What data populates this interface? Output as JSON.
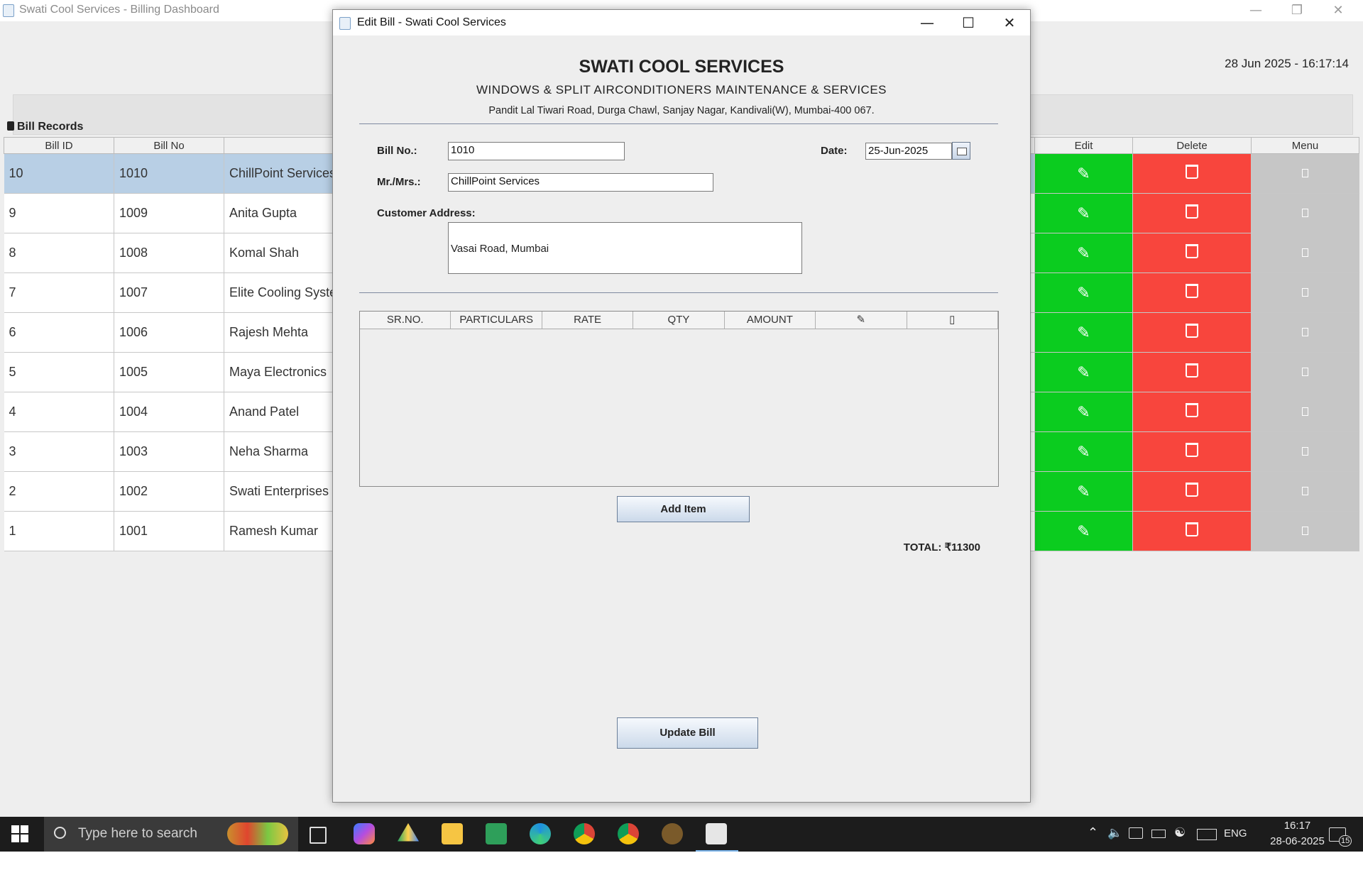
{
  "main_window": {
    "title": "Swati Cool Services - Billing Dashboard",
    "datetime": "28 Jun 2025 - 16:17:14",
    "records_label": "Bill Records",
    "columns": [
      "Bill ID",
      "Bill No",
      "Edit",
      "Delete",
      "Menu"
    ],
    "rows": [
      {
        "id": "10",
        "no": "1010",
        "name": "ChillPoint Services"
      },
      {
        "id": "9",
        "no": "1009",
        "name": "Anita Gupta"
      },
      {
        "id": "8",
        "no": "1008",
        "name": "Komal Shah"
      },
      {
        "id": "7",
        "no": "1007",
        "name": "Elite Cooling Syste"
      },
      {
        "id": "6",
        "no": "1006",
        "name": "Rajesh Mehta"
      },
      {
        "id": "5",
        "no": "1005",
        "name": "Maya Electronics"
      },
      {
        "id": "4",
        "no": "1004",
        "name": "Anand Patel"
      },
      {
        "id": "3",
        "no": "1003",
        "name": "Neha Sharma"
      },
      {
        "id": "2",
        "no": "1002",
        "name": "Swati Enterprises"
      },
      {
        "id": "1",
        "no": "1001",
        "name": "Ramesh Kumar"
      }
    ],
    "colors": {
      "edit": "#0bcc1f",
      "delete": "#f8453d",
      "menu": "#c6c6c6",
      "selected": "#b8cfe5"
    }
  },
  "dialog": {
    "title": "Edit Bill - Swati Cool Services",
    "company_name": "SWATI COOL SERVICES",
    "company_tagline": "WINDOWS & SPLIT AIRCONDITIONERS MAINTENANCE & SERVICES",
    "company_address": "Pandit Lal Tiwari Road, Durga Chawl, Sanjay Nagar, Kandivali(W), Mumbai-400 067.",
    "bill_no_label": "Bill No.:",
    "bill_no_value": "1010",
    "date_label": "Date:",
    "date_value": "25-Jun-2025",
    "customer_label": "Mr./Mrs.:",
    "customer_value": "ChillPoint Services",
    "address_label": "Customer Address:",
    "address_value": "Vasai Road, Mumbai",
    "item_columns": [
      "SR.NO.",
      "PARTICULARS",
      "RATE",
      "QTY",
      "AMOUNT",
      "✎",
      "▯"
    ],
    "add_item_label": "Add Item",
    "total_label": "TOTAL: ₹11300",
    "update_label": "Update Bill"
  },
  "taskbar": {
    "search_placeholder": "Type here to search",
    "language": "ENG",
    "time": "16:17",
    "date": "28-06-2025",
    "notification_count": "15"
  }
}
